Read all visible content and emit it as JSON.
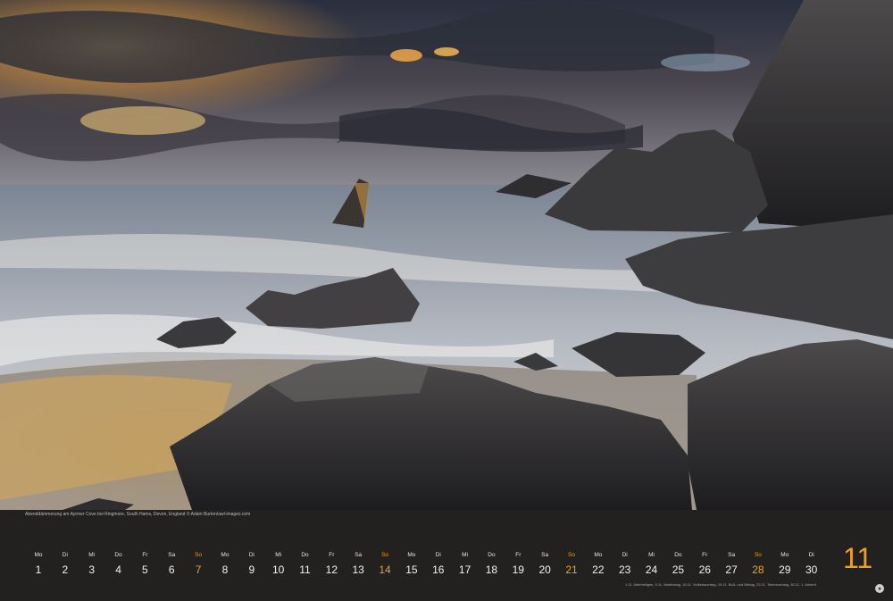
{
  "caption": "Abenddämmerung am Ayrmer Cove bei Ringmore, South Hams, Devon, England © Adam Burton/awl-images.com",
  "month": {
    "number": "11"
  },
  "days": [
    {
      "dn": "Mo",
      "num": "1"
    },
    {
      "dn": "Di",
      "num": "2"
    },
    {
      "dn": "Mi",
      "num": "3"
    },
    {
      "dn": "Do",
      "num": "4"
    },
    {
      "dn": "Fr",
      "num": "5"
    },
    {
      "dn": "Sa",
      "num": "6"
    },
    {
      "dn": "So",
      "num": "7"
    },
    {
      "dn": "Mo",
      "num": "8"
    },
    {
      "dn": "Di",
      "num": "9"
    },
    {
      "dn": "Mi",
      "num": "10"
    },
    {
      "dn": "Do",
      "num": "11"
    },
    {
      "dn": "Fr",
      "num": "12"
    },
    {
      "dn": "Sa",
      "num": "13"
    },
    {
      "dn": "So",
      "num": "14"
    },
    {
      "dn": "Mo",
      "num": "15"
    },
    {
      "dn": "Di",
      "num": "16"
    },
    {
      "dn": "Mi",
      "num": "17"
    },
    {
      "dn": "Do",
      "num": "18"
    },
    {
      "dn": "Fr",
      "num": "19"
    },
    {
      "dn": "Sa",
      "num": "20"
    },
    {
      "dn": "So",
      "num": "21"
    },
    {
      "dn": "Mo",
      "num": "22"
    },
    {
      "dn": "Di",
      "num": "23"
    },
    {
      "dn": "Mi",
      "num": "24"
    },
    {
      "dn": "Do",
      "num": "25"
    },
    {
      "dn": "Fr",
      "num": "26"
    },
    {
      "dn": "Sa",
      "num": "27"
    },
    {
      "dn": "So",
      "num": "28"
    },
    {
      "dn": "Mo",
      "num": "29"
    },
    {
      "dn": "Di",
      "num": "30"
    }
  ],
  "holidays_note": "1.11. Allerheiligen, 9.11. Martinstag, 16.11. Volkstrauertag, 19.11. Buß- und Bettag, 23.11. Totensonntag, 30.11. 1. Advent",
  "colors": {
    "sunday": "#f0a020",
    "strip": "#222120"
  },
  "icons": {
    "publisher": "publisher-logo"
  }
}
